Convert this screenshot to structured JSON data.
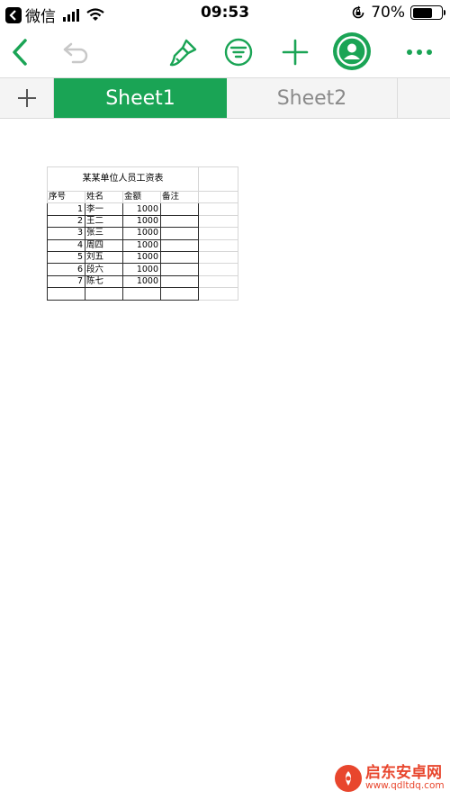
{
  "status_bar": {
    "app_back": "微信",
    "time": "09:53",
    "battery_percent": "70%",
    "battery_level": 0.7
  },
  "toolbar": {
    "icons": [
      "back-icon",
      "undo-icon",
      "format-brush-icon",
      "filter-icon",
      "add-icon",
      "collaborator-icon",
      "more-icon"
    ],
    "accent_color": "#1aa455",
    "disabled_color": "#c8c8c8"
  },
  "tabs": {
    "add_label": "+",
    "items": [
      {
        "label": "Sheet1",
        "active": true
      },
      {
        "label": "Sheet2",
        "active": false
      }
    ]
  },
  "sheet": {
    "title": "某某单位人员工资表",
    "headers": [
      "序号",
      "姓名",
      "金额",
      "备注"
    ],
    "rows": [
      {
        "no": "1",
        "name": "李一",
        "amount": "1000",
        "note": ""
      },
      {
        "no": "2",
        "name": "王二",
        "amount": "1000",
        "note": ""
      },
      {
        "no": "3",
        "name": "张三",
        "amount": "1000",
        "note": ""
      },
      {
        "no": "4",
        "name": "周四",
        "amount": "1000",
        "note": ""
      },
      {
        "no": "5",
        "name": "刘五",
        "amount": "1000",
        "note": ""
      },
      {
        "no": "6",
        "name": "段六",
        "amount": "1000",
        "note": ""
      },
      {
        "no": "7",
        "name": "陈七",
        "amount": "1000",
        "note": ""
      }
    ]
  },
  "watermark": {
    "title": "启东安卓网",
    "url": "www.qdltdq.com"
  }
}
